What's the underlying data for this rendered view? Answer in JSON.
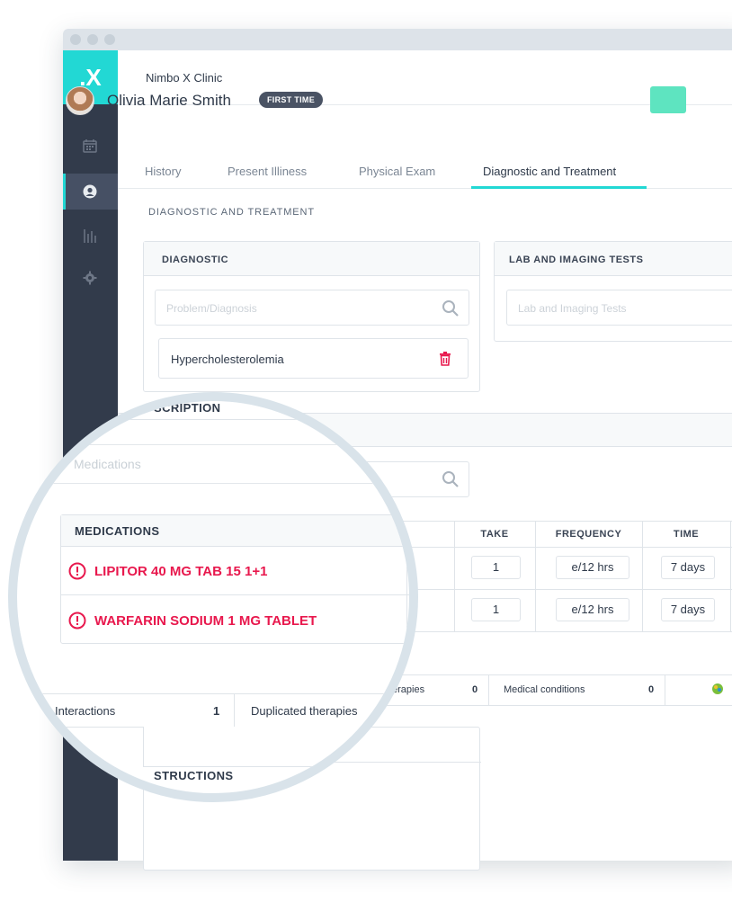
{
  "app": {
    "logo": ".X",
    "clinic_name": "Nimbo X Clinic"
  },
  "patient": {
    "name": "Olivia Marie Smith",
    "badge": "FIRST TIME"
  },
  "tabs": [
    {
      "label": "History",
      "active": false
    },
    {
      "label": "Present Illiness",
      "active": false
    },
    {
      "label": "Physical Exam",
      "active": false
    },
    {
      "label": "Diagnostic and Treatment",
      "active": true
    }
  ],
  "section_title": "DIAGNOSTIC AND TREATMENT",
  "diagnostic": {
    "title": "DIAGNOSTIC",
    "placeholder": "Problem/Diagnosis",
    "items": [
      "Hypercholesterolemia"
    ]
  },
  "lab": {
    "title": "LAB AND IMAGING TESTS",
    "placeholder": "Lab and Imaging Tests"
  },
  "prescription": {
    "title_partial": "SCRIPTION",
    "search_placeholder": "Medications"
  },
  "medications_table": {
    "headers": {
      "medications": "MEDICATIONS",
      "take": "TAKE",
      "frequency": "FREQUENCY",
      "time": "TIME"
    },
    "rows": [
      {
        "name": "LIPITOR 40 MG TAB 15 1+1",
        "take": "1",
        "frequency": "e/12 hrs",
        "time": "7 days"
      },
      {
        "name": "WARFARIN SODIUM 1 MG TABLET",
        "take": "1",
        "frequency": "e/12 hrs",
        "time": "7 days"
      }
    ]
  },
  "interactions_summary": {
    "therapies_label": "erapies",
    "therapies_count": "0",
    "conditions_label": "Medical conditions",
    "conditions_count": "0",
    "interactions_label": "Interactions",
    "interactions_count": "1",
    "duplicated_label": "Duplicated therapies"
  },
  "instructions": {
    "title_partial": "STRUCTIONS"
  },
  "colors": {
    "accent": "#22d8d4",
    "sidebar": "#323b4b",
    "alert": "#e8184d",
    "success_button": "#5ee4c0"
  },
  "icons": [
    "calendar-icon",
    "user-icon",
    "stats-icon",
    "gear-icon",
    "search-icon",
    "trash-icon",
    "alert-icon"
  ]
}
